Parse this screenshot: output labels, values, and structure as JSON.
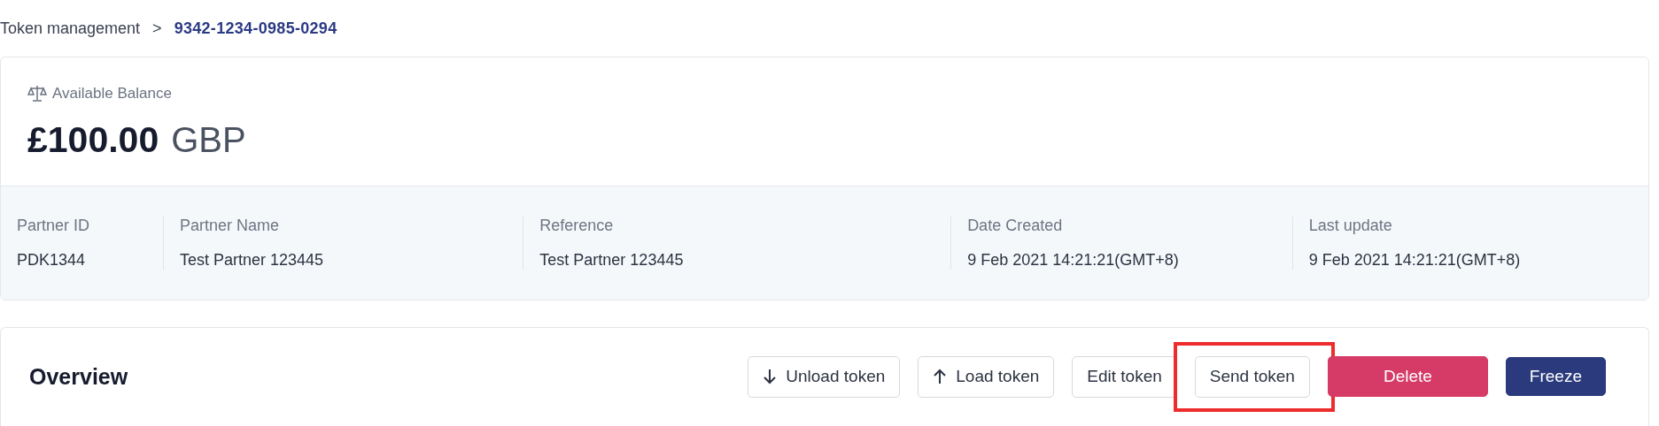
{
  "breadcrumb": {
    "parent": "Token management",
    "separator": ">",
    "current": "9342-1234-0985-0294"
  },
  "balance": {
    "label": "Available Balance",
    "amount": "£100.00",
    "currency": "GBP"
  },
  "details": [
    {
      "label": "Partner ID",
      "value": "PDK1344"
    },
    {
      "label": "Partner Name",
      "value": "Test Partner 123445"
    },
    {
      "label": "Reference",
      "value": "Test Partner 123445"
    },
    {
      "label": "Date Created",
      "value": "9 Feb 2021 14:21:21(GMT+8)"
    },
    {
      "label": "Last update",
      "value": "9 Feb 2021 14:21:21(GMT+8)"
    }
  ],
  "overview": {
    "title": "Overview",
    "buttons": [
      {
        "label": "Unload token",
        "kind": "arrow-down",
        "highlighted": false
      },
      {
        "label": "Load token",
        "kind": "arrow-up",
        "highlighted": false
      },
      {
        "label": "Edit token",
        "kind": "outline",
        "highlighted": false
      },
      {
        "label": "Send token",
        "kind": "outline",
        "highlighted": true
      },
      {
        "label": "Delete",
        "kind": "danger",
        "highlighted": false
      },
      {
        "label": "Freeze",
        "kind": "primary",
        "highlighted": false
      }
    ]
  }
}
